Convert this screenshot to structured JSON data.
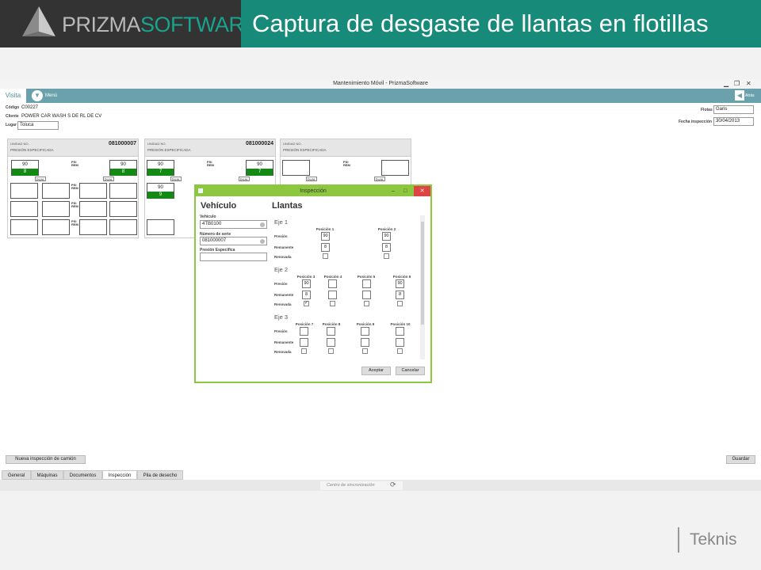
{
  "slide": {
    "logo_part1": "PRIZMA",
    "logo_part2": "SOFTWARE",
    "title": "Captura de desgaste de llantas en flotillas",
    "footer_brand": "Teknis"
  },
  "window": {
    "title": "Mantenimiento Móvil - PrizmaSoftware",
    "minimize": "▁",
    "maximize": "❐",
    "close": "✕"
  },
  "topbar": {
    "tab": "Visita",
    "menu": "Menú",
    "back": "Atrás"
  },
  "header_info": {
    "codigo_label": "Código",
    "codigo": "C00227",
    "cliente_label": "Cliente",
    "cliente": "POWER CAR WASH S DE RL DE CV",
    "lugar_label": "Lugar",
    "lugar": "Toluca",
    "flotas_label": "Flotas",
    "flotas": "Garis",
    "fecha_label": "Fecha inspección",
    "fecha": "30/04/2013"
  },
  "cards": [
    {
      "unit_label": "UNIDAD NO.",
      "unit_no": "081000007",
      "presion": "PRESIÓN ESPECIFICADA",
      "psi": "PSI",
      "rem": "REM",
      "dual": "DUAL",
      "t1": "90",
      "t1g": "8",
      "t2": "90",
      "t2g": "8"
    },
    {
      "unit_label": "UNIDAD NO.",
      "unit_no": "081000024",
      "presion": "PRESIÓN ESPECIFICADA",
      "psi": "PSI",
      "rem": "REM",
      "dual": "DUAL",
      "t1": "90",
      "t1g": "7",
      "t2": "90",
      "t2g": "7",
      "t3": "90",
      "t3g": "9"
    },
    {
      "unit_label": "UNIDAD NO.",
      "unit_no": "",
      "presion": "PRESIÓN ESPECIFICADA",
      "psi": "PSI",
      "rem": "REM",
      "dual": "DUAL"
    }
  ],
  "dialog": {
    "title": "Inspección",
    "minimize": "–",
    "maximize": "□",
    "close": "✕",
    "vehiculo_heading": "Vehículo",
    "llantas_heading": "Llantas",
    "vehiculo_label": "Vehículo",
    "vehiculo": "4TB0100",
    "serie_label": "Número de serie",
    "serie": "081000007",
    "presion_label": "Presión Específica",
    "presion": "",
    "row_presion": "Presión",
    "row_remanente": "Remanente",
    "row_renovada": "Renovada",
    "eje1": "Eje 1",
    "eje2": "Eje 2",
    "eje3": "Eje 3",
    "pos1": "Posición 1",
    "pos2": "Posición 2",
    "pos3": "Posición 3",
    "pos4": "Posición 4",
    "pos5": "Posición 5",
    "pos6": "Posición 6",
    "pos7": "Posición 7",
    "pos8": "Posición 8",
    "pos9": "Posición 9",
    "pos10": "Posición 10",
    "p1_presion": "90",
    "p1_rem": "8",
    "p2_presion": "90",
    "p2_rem": "8",
    "p3_presion": "90",
    "p3_rem": "8",
    "p3_renovada": "✓",
    "p6_presion": "90",
    "p6_rem": "8",
    "aceptar": "Aceptar",
    "cancelar": "Cancelar"
  },
  "bottom": {
    "new_inspection": "Nueva inspección de camión",
    "save": "Guardar",
    "tabs": [
      "General",
      "Máquinas",
      "Documentos",
      "Inspección",
      "Pila de desecho"
    ],
    "sync": "Centro de sincronización",
    "sync_icon": "⟳"
  }
}
